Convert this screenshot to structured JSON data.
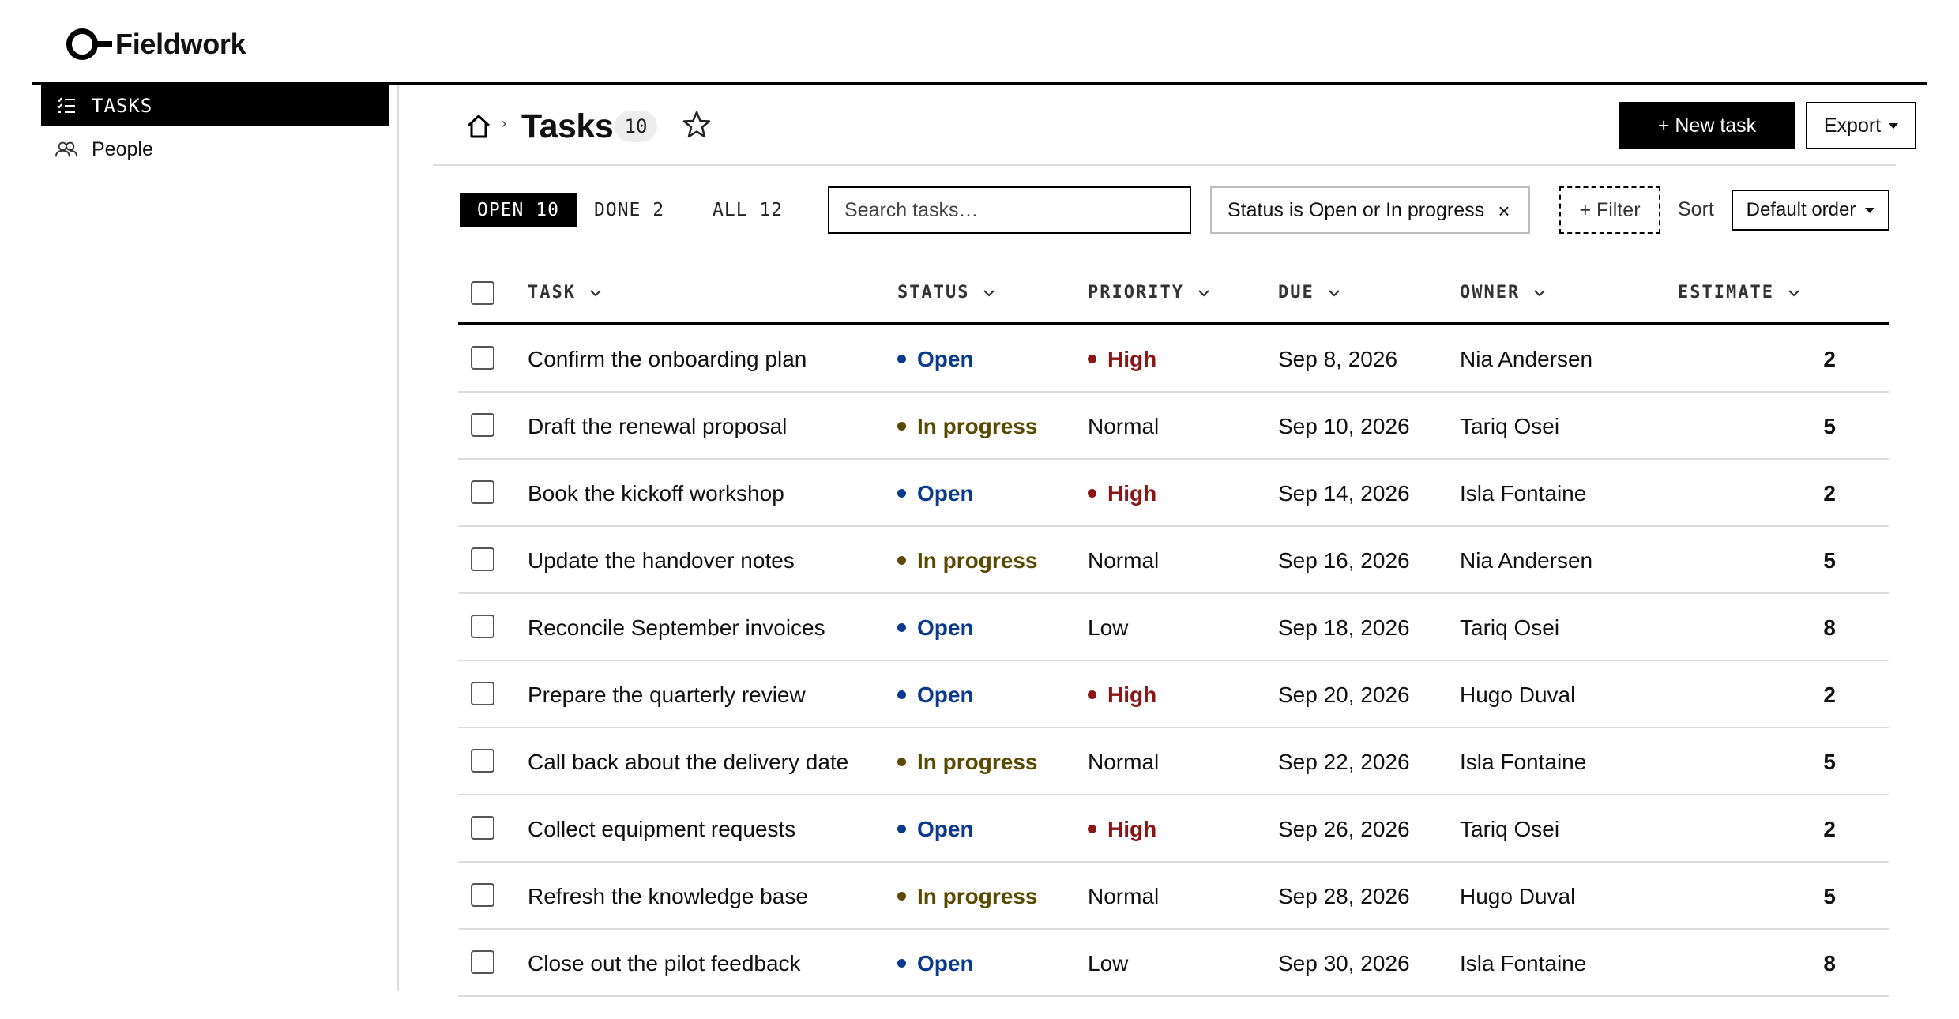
{
  "brand": {
    "name": "Fieldwork"
  },
  "sidebar": {
    "items": [
      {
        "label": "TASKS",
        "icon": "checklist-icon",
        "active": true
      },
      {
        "label": "People",
        "icon": "people-icon",
        "active": false
      }
    ]
  },
  "header": {
    "title": "Tasks",
    "count": "10",
    "new_task_label": "+ New task",
    "export_label": "Export"
  },
  "tabs": [
    {
      "label": "OPEN 10",
      "active": true
    },
    {
      "label": "DONE 2",
      "active": false
    },
    {
      "label": "ALL 12",
      "active": false
    }
  ],
  "search": {
    "placeholder": "Search tasks…",
    "value": ""
  },
  "filter_chip": {
    "label": "Status is Open or In progress",
    "remove": "×"
  },
  "filter_button": {
    "label": "+ Filter"
  },
  "sort": {
    "label": "Sort",
    "value": "Default order"
  },
  "columns": [
    "TASK",
    "STATUS",
    "PRIORITY",
    "DUE",
    "OWNER",
    "ESTIMATE"
  ],
  "colors": {
    "open": "#0a3a8c",
    "in_progress": "#5a4a00",
    "high": "#8b1515",
    "accent": "#000000"
  },
  "rows": [
    {
      "task": "Confirm the onboarding plan",
      "status": "Open",
      "priority": "High",
      "due": "Sep 8, 2026",
      "owner": "Nia Andersen",
      "estimate": "2"
    },
    {
      "task": "Draft the renewal proposal",
      "status": "In progress",
      "priority": "Normal",
      "due": "Sep 10, 2026",
      "owner": "Tariq Osei",
      "estimate": "5"
    },
    {
      "task": "Book the kickoff workshop",
      "status": "Open",
      "priority": "High",
      "due": "Sep 14, 2026",
      "owner": "Isla Fontaine",
      "estimate": "2"
    },
    {
      "task": "Update the handover notes",
      "status": "In progress",
      "priority": "Normal",
      "due": "Sep 16, 2026",
      "owner": "Nia Andersen",
      "estimate": "5"
    },
    {
      "task": "Reconcile September invoices",
      "status": "Open",
      "priority": "Low",
      "due": "Sep 18, 2026",
      "owner": "Tariq Osei",
      "estimate": "8"
    },
    {
      "task": "Prepare the quarterly review",
      "status": "Open",
      "priority": "High",
      "due": "Sep 20, 2026",
      "owner": "Hugo Duval",
      "estimate": "2"
    },
    {
      "task": "Call back about the delivery date",
      "status": "In progress",
      "priority": "Normal",
      "due": "Sep 22, 2026",
      "owner": "Isla Fontaine",
      "estimate": "5"
    },
    {
      "task": "Collect equipment requests",
      "status": "Open",
      "priority": "High",
      "due": "Sep 26, 2026",
      "owner": "Tariq Osei",
      "estimate": "2"
    },
    {
      "task": "Refresh the knowledge base",
      "status": "In progress",
      "priority": "Normal",
      "due": "Sep 28, 2026",
      "owner": "Hugo Duval",
      "estimate": "5"
    },
    {
      "task": "Close out the pilot feedback",
      "status": "Open",
      "priority": "Low",
      "due": "Sep 30, 2026",
      "owner": "Isla Fontaine",
      "estimate": "8"
    }
  ]
}
